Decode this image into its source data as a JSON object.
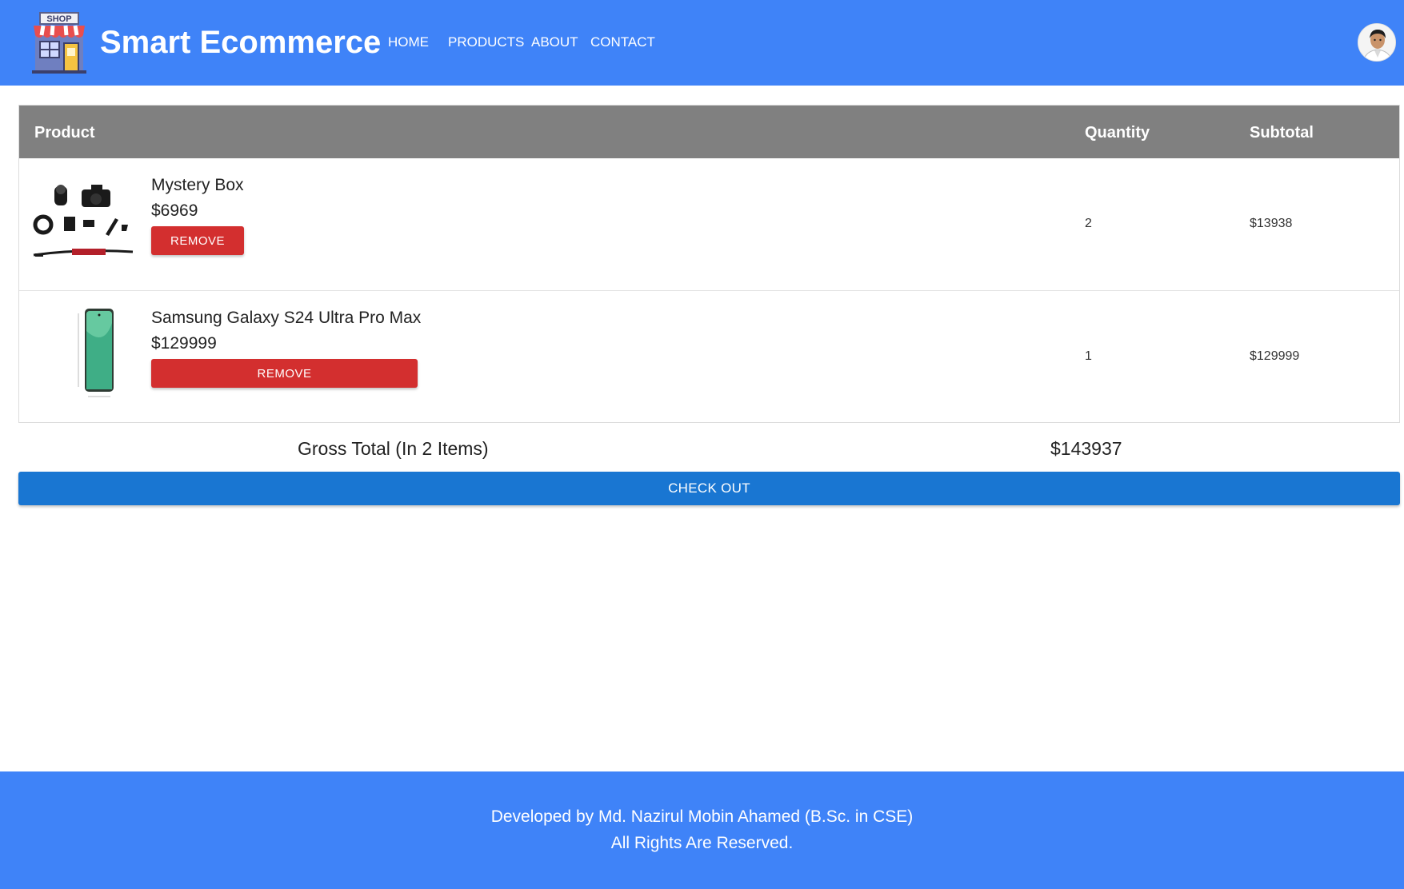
{
  "header": {
    "logo_text": "SHOP",
    "brand": "Smart Ecommerce",
    "nav": [
      {
        "label": "HOME"
      },
      {
        "label": "PRODUCTS"
      },
      {
        "label": "ABOUT"
      },
      {
        "label": "CONTACT"
      }
    ],
    "avatar_icon": "user-avatar"
  },
  "cart": {
    "columns": {
      "product": "Product",
      "quantity": "Quantity",
      "subtotal": "Subtotal"
    },
    "items": [
      {
        "name": "Mystery Box",
        "price": "$6969",
        "remove_label": "REMOVE",
        "quantity": "2",
        "subtotal": "$13938",
        "image_icon": "camera-kit-image"
      },
      {
        "name": "Samsung Galaxy S24 Ultra Pro Max",
        "price": "$129999",
        "remove_label": "REMOVE",
        "quantity": "1",
        "subtotal": "$129999",
        "image_icon": "smartphone-image"
      }
    ]
  },
  "totals": {
    "gross_label": "Gross Total (In 2 Items)",
    "gross_value": "$143937",
    "checkout_label": "CHECK OUT"
  },
  "footer": {
    "line1": "Developed by Md. Nazirul Mobin Ahamed (B.Sc. in CSE)",
    "line2": "All Rights Are Reserved."
  },
  "colors": {
    "header_bg": "#3f83f8",
    "table_header_bg": "#808080",
    "remove_button": "#d32f2f",
    "checkout_button": "#1976d2"
  }
}
